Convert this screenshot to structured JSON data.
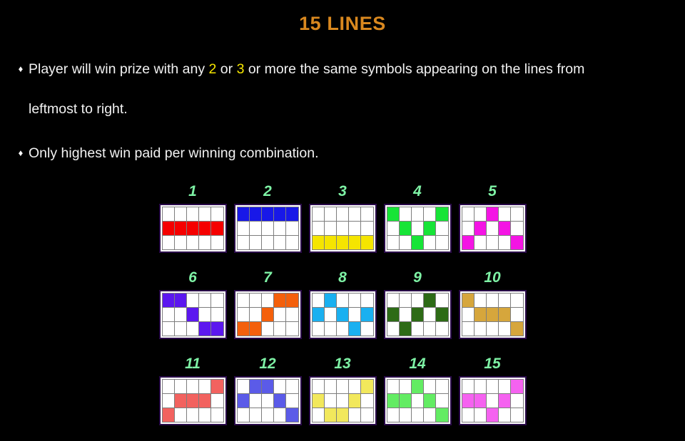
{
  "title": "15 LINES",
  "colors": {
    "background": "#000000",
    "title": "#d9881f",
    "number": "#7ef2a5",
    "highlight": "#f5e500",
    "text": "#f2f2f2",
    "grid_border": "#2a0a4a",
    "grid_lines": "#7d7d7d",
    "cell_empty": "#ffffff"
  },
  "rules": {
    "bullet_glyph": "♦",
    "rule1_part1": "Player will win prize with any ",
    "rule1_num1": "2",
    "rule1_part2": " or ",
    "rule1_num2": "3",
    "rule1_part3": " or more the same symbols appearing on the lines from",
    "rule1_line2": "leftmost to right.",
    "rule2": "Only highest win paid per winning combination."
  },
  "chart_data": {
    "type": "table",
    "title": "15 LINES",
    "rows": 3,
    "cols": 5,
    "description": "Slot machine payline patterns on a 5-reel by 3-row grid. Each cell lists the row index (0=top) highlighted for each of the 5 reels.",
    "paylines": [
      {
        "number": "1",
        "color": "#f50000",
        "pattern": [
          1,
          1,
          1,
          1,
          1
        ]
      },
      {
        "number": "2",
        "color": "#1818e8",
        "pattern": [
          0,
          0,
          0,
          0,
          0
        ]
      },
      {
        "number": "3",
        "color": "#f5e500",
        "pattern": [
          2,
          2,
          2,
          2,
          2
        ]
      },
      {
        "number": "4",
        "color": "#17e437",
        "pattern": [
          0,
          1,
          2,
          1,
          0
        ]
      },
      {
        "number": "5",
        "color": "#f414e4",
        "pattern": [
          2,
          1,
          0,
          1,
          2
        ]
      },
      {
        "number": "6",
        "color": "#5c17ef",
        "pattern": [
          0,
          0,
          1,
          2,
          2
        ]
      },
      {
        "number": "7",
        "color": "#f4600c",
        "pattern": [
          2,
          2,
          1,
          0,
          0
        ]
      },
      {
        "number": "8",
        "color": "#1ab0f0",
        "pattern": [
          1,
          0,
          1,
          2,
          1
        ]
      },
      {
        "number": "9",
        "color": "#2d6b16",
        "pattern": [
          1,
          2,
          1,
          0,
          1
        ]
      },
      {
        "number": "10",
        "color": "#d6a63c",
        "pattern": [
          0,
          1,
          1,
          1,
          2
        ]
      },
      {
        "number": "11",
        "color": "#f2625f",
        "pattern": [
          2,
          1,
          1,
          1,
          0
        ]
      },
      {
        "number": "12",
        "color": "#5b5be8",
        "pattern": [
          1,
          0,
          0,
          1,
          2
        ]
      },
      {
        "number": "13",
        "color": "#f2e85c",
        "pattern": [
          1,
          2,
          2,
          1,
          0
        ]
      },
      {
        "number": "14",
        "color": "#63ec63",
        "pattern": [
          1,
          1,
          0,
          1,
          2
        ]
      },
      {
        "number": "15",
        "color": "#f562f0",
        "pattern": [
          1,
          1,
          2,
          1,
          0
        ]
      }
    ]
  }
}
